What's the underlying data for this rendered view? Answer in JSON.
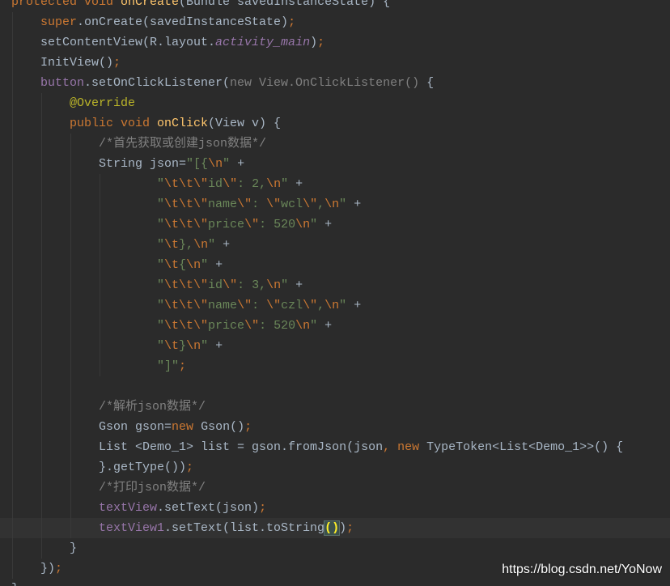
{
  "theme": {
    "editor_bg": "#2B2B2B",
    "current_line_bg": "#323232",
    "indent_guide": "#393939",
    "watermark_color": "#FFFFFF"
  },
  "editor": {
    "current_line": 27,
    "lines": [
      [
        {
          "t": "protected void ",
          "c": "#CC7832"
        },
        {
          "t": "onCreate",
          "c": "#FFC66D"
        },
        {
          "t": "(Bundle savedInstanceState) {",
          "c": "#A9B7C6"
        }
      ],
      [
        {
          "t": "    super",
          "c": "#CC7832"
        },
        {
          "t": ".onCreate(savedInstanceState)",
          "c": "#A9B7C6"
        },
        {
          "t": ";",
          "c": "#CC7832"
        }
      ],
      [
        {
          "t": "    setContentView(R.layout.",
          "c": "#A9B7C6"
        },
        {
          "t": "activity_main",
          "c": "#9876AA",
          "i": true
        },
        {
          "t": ")",
          "c": "#A9B7C6"
        },
        {
          "t": ";",
          "c": "#CC7832"
        }
      ],
      [
        {
          "t": "    InitView()",
          "c": "#A9B7C6"
        },
        {
          "t": ";",
          "c": "#CC7832"
        }
      ],
      [
        {
          "t": "    button",
          "c": "#9876AA"
        },
        {
          "t": ".setOnClickListener(",
          "c": "#A9B7C6"
        },
        {
          "t": "new View.OnClickListener()",
          "c": "#808080"
        },
        {
          "t": " {",
          "c": "#A9B7C6"
        }
      ],
      [
        {
          "t": "        @Override",
          "c": "#BBB529"
        }
      ],
      [
        {
          "t": "        public void ",
          "c": "#CC7832"
        },
        {
          "t": "onClick",
          "c": "#FFC66D"
        },
        {
          "t": "(View v) {",
          "c": "#A9B7C6"
        }
      ],
      [
        {
          "t": "            /*首先获取或创建json数据*/",
          "c": "#808080"
        }
      ],
      [
        {
          "t": "            String json=",
          "c": "#A9B7C6"
        },
        {
          "t": "\"[{",
          "c": "#6A8759"
        },
        {
          "t": "\\n",
          "c": "#CC7832"
        },
        {
          "t": "\"",
          "c": "#6A8759"
        },
        {
          "t": " +",
          "c": "#A9B7C6"
        }
      ],
      [
        {
          "t": "                    \"",
          "c": "#6A8759"
        },
        {
          "t": "\\t\\t\\\"",
          "c": "#CC7832"
        },
        {
          "t": "id",
          "c": "#6A8759"
        },
        {
          "t": "\\\"",
          "c": "#CC7832"
        },
        {
          "t": ": 2,",
          "c": "#6A8759"
        },
        {
          "t": "\\n",
          "c": "#CC7832"
        },
        {
          "t": "\"",
          "c": "#6A8759"
        },
        {
          "t": " +",
          "c": "#A9B7C6"
        }
      ],
      [
        {
          "t": "                    \"",
          "c": "#6A8759"
        },
        {
          "t": "\\t\\t\\\"",
          "c": "#CC7832"
        },
        {
          "t": "name",
          "c": "#6A8759"
        },
        {
          "t": "\\\"",
          "c": "#CC7832"
        },
        {
          "t": ": ",
          "c": "#6A8759"
        },
        {
          "t": "\\\"",
          "c": "#CC7832"
        },
        {
          "t": "wcl",
          "c": "#6A8759"
        },
        {
          "t": "\\\"",
          "c": "#CC7832"
        },
        {
          "t": ",",
          "c": "#6A8759"
        },
        {
          "t": "\\n",
          "c": "#CC7832"
        },
        {
          "t": "\"",
          "c": "#6A8759"
        },
        {
          "t": " +",
          "c": "#A9B7C6"
        }
      ],
      [
        {
          "t": "                    \"",
          "c": "#6A8759"
        },
        {
          "t": "\\t\\t\\\"",
          "c": "#CC7832"
        },
        {
          "t": "price",
          "c": "#6A8759"
        },
        {
          "t": "\\\"",
          "c": "#CC7832"
        },
        {
          "t": ": 520",
          "c": "#6A8759"
        },
        {
          "t": "\\n",
          "c": "#CC7832"
        },
        {
          "t": "\"",
          "c": "#6A8759"
        },
        {
          "t": " +",
          "c": "#A9B7C6"
        }
      ],
      [
        {
          "t": "                    \"",
          "c": "#6A8759"
        },
        {
          "t": "\\t",
          "c": "#CC7832"
        },
        {
          "t": "},",
          "c": "#6A8759"
        },
        {
          "t": "\\n",
          "c": "#CC7832"
        },
        {
          "t": "\"",
          "c": "#6A8759"
        },
        {
          "t": " +",
          "c": "#A9B7C6"
        }
      ],
      [
        {
          "t": "                    \"",
          "c": "#6A8759"
        },
        {
          "t": "\\t",
          "c": "#CC7832"
        },
        {
          "t": "{",
          "c": "#6A8759"
        },
        {
          "t": "\\n",
          "c": "#CC7832"
        },
        {
          "t": "\"",
          "c": "#6A8759"
        },
        {
          "t": " +",
          "c": "#A9B7C6"
        }
      ],
      [
        {
          "t": "                    \"",
          "c": "#6A8759"
        },
        {
          "t": "\\t\\t\\\"",
          "c": "#CC7832"
        },
        {
          "t": "id",
          "c": "#6A8759"
        },
        {
          "t": "\\\"",
          "c": "#CC7832"
        },
        {
          "t": ": 3,",
          "c": "#6A8759"
        },
        {
          "t": "\\n",
          "c": "#CC7832"
        },
        {
          "t": "\"",
          "c": "#6A8759"
        },
        {
          "t": " +",
          "c": "#A9B7C6"
        }
      ],
      [
        {
          "t": "                    \"",
          "c": "#6A8759"
        },
        {
          "t": "\\t\\t\\\"",
          "c": "#CC7832"
        },
        {
          "t": "name",
          "c": "#6A8759"
        },
        {
          "t": "\\\"",
          "c": "#CC7832"
        },
        {
          "t": ": ",
          "c": "#6A8759"
        },
        {
          "t": "\\\"",
          "c": "#CC7832"
        },
        {
          "t": "czl",
          "c": "#6A8759"
        },
        {
          "t": "\\\"",
          "c": "#CC7832"
        },
        {
          "t": ",",
          "c": "#6A8759"
        },
        {
          "t": "\\n",
          "c": "#CC7832"
        },
        {
          "t": "\"",
          "c": "#6A8759"
        },
        {
          "t": " +",
          "c": "#A9B7C6"
        }
      ],
      [
        {
          "t": "                    \"",
          "c": "#6A8759"
        },
        {
          "t": "\\t\\t\\\"",
          "c": "#CC7832"
        },
        {
          "t": "price",
          "c": "#6A8759"
        },
        {
          "t": "\\\"",
          "c": "#CC7832"
        },
        {
          "t": ": 520",
          "c": "#6A8759"
        },
        {
          "t": "\\n",
          "c": "#CC7832"
        },
        {
          "t": "\"",
          "c": "#6A8759"
        },
        {
          "t": " +",
          "c": "#A9B7C6"
        }
      ],
      [
        {
          "t": "                    \"",
          "c": "#6A8759"
        },
        {
          "t": "\\t",
          "c": "#CC7832"
        },
        {
          "t": "}",
          "c": "#6A8759"
        },
        {
          "t": "\\n",
          "c": "#CC7832"
        },
        {
          "t": "\"",
          "c": "#6A8759"
        },
        {
          "t": " +",
          "c": "#A9B7C6"
        }
      ],
      [
        {
          "t": "                    \"]\"",
          "c": "#6A8759"
        },
        {
          "t": ";",
          "c": "#CC7832"
        }
      ],
      [],
      [
        {
          "t": "            /*解析json数据*/",
          "c": "#808080"
        }
      ],
      [
        {
          "t": "            Gson gson=",
          "c": "#A9B7C6"
        },
        {
          "t": "new",
          "c": "#CC7832"
        },
        {
          "t": " Gson()",
          "c": "#A9B7C6"
        },
        {
          "t": ";",
          "c": "#CC7832"
        }
      ],
      [
        {
          "t": "            List <Demo_1> list = gson.fromJson(json",
          "c": "#A9B7C6"
        },
        {
          "t": ",",
          "c": "#CC7832"
        },
        {
          "t": " new",
          "c": "#CC7832"
        },
        {
          "t": " TypeToken<List<Demo_1>>() {",
          "c": "#A9B7C6"
        }
      ],
      [
        {
          "t": "            }.getType())",
          "c": "#A9B7C6"
        },
        {
          "t": ";",
          "c": "#CC7832"
        }
      ],
      [
        {
          "t": "            /*打印json数据*/",
          "c": "#808080"
        }
      ],
      [
        {
          "t": "            textView",
          "c": "#9876AA"
        },
        {
          "t": ".setText(json)",
          "c": "#A9B7C6"
        },
        {
          "t": ";",
          "c": "#CC7832"
        }
      ],
      [
        {
          "t": "            textView1",
          "c": "#9876AA"
        },
        {
          "t": ".setText(list.toString",
          "c": "#A9B7C6"
        },
        {
          "t": "()",
          "c": "#FFEF28",
          "bg": "#3B514D",
          "b": true
        },
        {
          "t": ")",
          "c": "#A9B7C6"
        },
        {
          "t": ";",
          "c": "#CC7832"
        }
      ],
      [
        {
          "t": "        }",
          "c": "#A9B7C6"
        }
      ],
      [
        {
          "t": "    })",
          "c": "#A9B7C6"
        },
        {
          "t": ";",
          "c": "#CC7832"
        }
      ],
      [
        {
          "t": "}",
          "c": "#A9B7C6"
        }
      ]
    ]
  },
  "watermark": "https://blog.csdn.net/YoNow"
}
